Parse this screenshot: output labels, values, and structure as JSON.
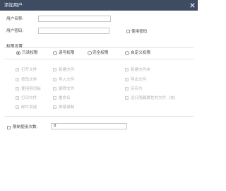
{
  "dialog": {
    "title": "添加用户"
  },
  "form": {
    "username_label": "用户名称:",
    "username_value": "",
    "password_label": "用户密码:",
    "password_value": "",
    "use_password_label": "使用密码"
  },
  "permissions": {
    "section_title": "权限设置",
    "modes": [
      {
        "label": "只读权限",
        "selected": true
      },
      {
        "label": "读写权限",
        "selected": false
      },
      {
        "label": "完全权限",
        "selected": false
      },
      {
        "label": "自定义权限",
        "selected": false
      }
    ],
    "items": [
      [
        "打开文件",
        "新建文件",
        "新建文件夹"
      ],
      [
        "修改文件",
        "导入文件",
        "导出文件"
      ],
      [
        "使用剪切板",
        "删除文件",
        "另存为"
      ],
      [
        "打印文件",
        "重命名",
        "运行隐藏属性的文件（夹）"
      ],
      [
        "邮件发送",
        "屏幕录制",
        ""
      ]
    ]
  },
  "limit": {
    "label": "限制使用次数:",
    "value": "0"
  }
}
